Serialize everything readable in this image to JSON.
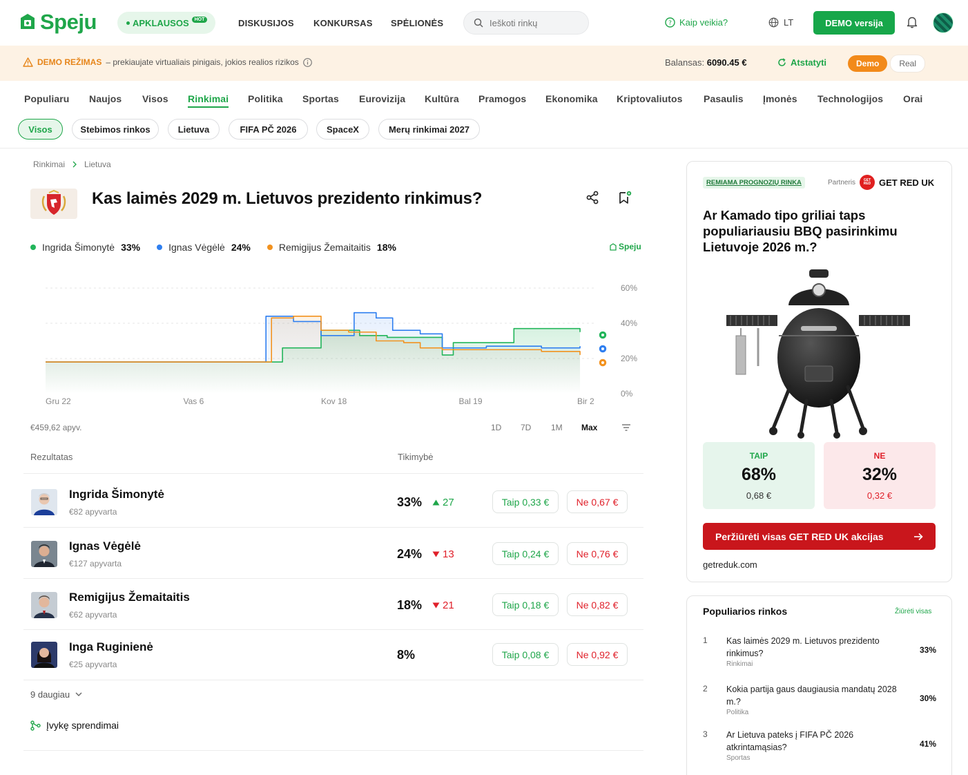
{
  "header": {
    "logo": "Speju",
    "polls_label": "APKLAUSOS",
    "hot_badge": "HOT",
    "nav": [
      "DISKUSIJOS",
      "KONKURSAS",
      "SPĖLIONĖS"
    ],
    "search_placeholder": "Ieškoti rinkų",
    "how_it_works": "Kaip veikia?",
    "language": "LT",
    "demo_button": "DEMO versija"
  },
  "banner": {
    "mode_label": "DEMO REŽIMAS",
    "message": "– prekiaujate virtualiais pinigais, jokios realios rizikos",
    "balance_label": "Balansas:",
    "balance_value": "6090.45 €",
    "reset_label": "Atstatyti",
    "mode_demo": "Demo",
    "mode_real": "Real"
  },
  "categories": [
    "Populiaru",
    "Naujos",
    "Visos",
    "Rinkimai",
    "Politika",
    "Sportas",
    "Eurovizija",
    "Kultūra",
    "Pramogos",
    "Ekonomika",
    "Kriptovaliutos",
    "Pasaulis",
    "Įmonės",
    "Technologijos",
    "Orai"
  ],
  "active_category": "Rinkimai",
  "chips": [
    "Visos",
    "Stebimos rinkos",
    "Lietuva",
    "FIFA PČ 2026",
    "SpaceX",
    "Merų rinkimai 2027"
  ],
  "breadcrumb": [
    "Rinkimai",
    "Lietuva"
  ],
  "market": {
    "title": "Kas laimės 2029 m. Lietuvos prezidento rinkimus?",
    "watermark": "Speju",
    "volume": "€459,62 apyv.",
    "ranges": [
      "1D",
      "7D",
      "1M",
      "Max"
    ],
    "active_range": "Max"
  },
  "chart_data": {
    "type": "line",
    "x_tick_labels": [
      "Gru 22",
      "Vas 6",
      "Kov 18",
      "Bal 19",
      "Bir 2"
    ],
    "y_ticks": [
      "60%",
      "40%",
      "20%",
      "0%"
    ],
    "ylim": [
      0,
      60
    ],
    "grid": true,
    "legend": "top-left",
    "series": [
      {
        "name": "Ingrida Šimonytė",
        "current": "33%",
        "color": "#22b55a",
        "x": [
          0,
          0.395,
          0.43,
          0.49,
          0.5,
          0.57,
          0.62,
          0.72,
          0.74,
          0.8,
          0.85,
          0.96,
          0.97
        ],
        "values": [
          18,
          18,
          26,
          26,
          36,
          33,
          32,
          22,
          29,
          29,
          37,
          37,
          35
        ]
      },
      {
        "name": "Ignas Vėgėlė",
        "current": "24%",
        "color": "#2f7ff0",
        "x": [
          0,
          0.395,
          0.4,
          0.45,
          0.5,
          0.53,
          0.56,
          0.6,
          0.63,
          0.68,
          0.72,
          0.8,
          0.9,
          0.97
        ],
        "values": [
          18,
          18,
          44,
          41,
          33,
          33,
          46,
          43,
          36,
          34,
          26,
          27,
          26,
          27
        ]
      },
      {
        "name": "Remigijus Žemaitaitis",
        "current": "18%",
        "color": "#f2921f",
        "x": [
          0,
          0.395,
          0.41,
          0.45,
          0.5,
          0.55,
          0.6,
          0.65,
          0.68,
          0.72,
          0.8,
          0.9,
          0.97
        ],
        "values": [
          18,
          18,
          43,
          44,
          36,
          35,
          30,
          29,
          26,
          25,
          25,
          24,
          22
        ]
      }
    ]
  },
  "table": {
    "col_outcome": "Rezultatas",
    "col_prob": "Tikimybė",
    "rows": [
      {
        "name": "Ingrida Šimonytė",
        "volume": "€82 apyvarta",
        "pct": "33%",
        "change": "27",
        "dir": "up",
        "yes": "Taip 0,33 €",
        "no": "Ne 0,67 €"
      },
      {
        "name": "Ignas Vėgėlė",
        "volume": "€127 apyvarta",
        "pct": "24%",
        "change": "13",
        "dir": "down",
        "yes": "Taip 0,24 €",
        "no": "Ne 0,76 €"
      },
      {
        "name": "Remigijus Žemaitaitis",
        "volume": "€62 apyvarta",
        "pct": "18%",
        "change": "21",
        "dir": "down",
        "yes": "Taip 0,18 €",
        "no": "Ne 0,82 €"
      },
      {
        "name": "Inga Ruginienė",
        "volume": "€25 apyvarta",
        "pct": "8%",
        "change": "",
        "dir": "",
        "yes": "Taip 0,08 €",
        "no": "Ne 0,92 €"
      }
    ],
    "more": "9 daugiau",
    "resolved": "Įvykę sprendimai"
  },
  "ad": {
    "badge": "REMIAMA PROGNOZIŲ RINKA",
    "partner_label": "Partneris",
    "partner_logo": "GET RED",
    "partner_name": "GET RED UK",
    "question": "Ar Kamado tipo griliai taps populiariausiu BBQ pasirinkimu Lietuvoje 2026 m.?",
    "yes_label": "TAIP",
    "yes_pct": "68%",
    "yes_price": "0,68 €",
    "no_label": "NE",
    "no_pct": "32%",
    "no_price": "0,32 €",
    "cta": "Peržiūrėti visas GET RED UK akcijas",
    "domain": "getreduk.com"
  },
  "popular": {
    "title": "Populiarios rinkos",
    "see_all": "Žiūrėti visas",
    "items": [
      {
        "n": "1",
        "q": "Kas laimės 2029 m. Lietuvos prezidento rinkimus?",
        "cat": "Rinkimai",
        "pct": "33%"
      },
      {
        "n": "2",
        "q": "Kokia partija gaus daugiausia mandatų 2028 m.?",
        "cat": "Politika",
        "pct": "30%"
      },
      {
        "n": "3",
        "q": "Ar Lietuva pateks į FIFA PČ 2026 atkrintamąsias?",
        "cat": "Sportas",
        "pct": "41%"
      }
    ]
  },
  "colors": {
    "brand": "#1fa64a",
    "accent_orange": "#f28a1a",
    "no_red": "#e0202a",
    "cta_red": "#c9161c"
  }
}
